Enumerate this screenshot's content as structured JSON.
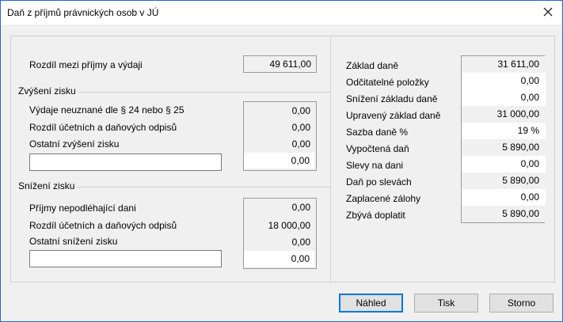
{
  "window": {
    "title": "Daň z příjmů právnických osob v JÚ"
  },
  "left": {
    "diff_label": "Rozdíl mezi příjmy a výdaji",
    "diff_value": "49 611,00",
    "increase": {
      "title": "Zvýšení zisku",
      "rows": [
        {
          "label": "Výdaje neuznané dle § 24 nebo § 25",
          "value": "0,00"
        },
        {
          "label": "Rozdíl účetních a daňových odpisů",
          "value": "0,00"
        },
        {
          "label": "Ostatní zvýšení zisku",
          "value": "0,00"
        }
      ],
      "custom_label_value": "",
      "custom_value": "0,00"
    },
    "decrease": {
      "title": "Snížení zisku",
      "rows": [
        {
          "label": "Příjmy nepodléhající dani",
          "value": "0,00"
        },
        {
          "label": "Rozdíl účetních a daňových odpisů",
          "value": "18 000,00"
        },
        {
          "label": "Ostatní snížení zisku",
          "value": "0,00"
        }
      ],
      "custom_label_value": "",
      "custom_value": "0,00"
    }
  },
  "right": {
    "rows": [
      {
        "label": "Základ daně",
        "value": "31 611,00"
      },
      {
        "label": "Odčitatelné položky",
        "value": "0,00"
      },
      {
        "label": "Snížení základu daně",
        "value": "0,00"
      },
      {
        "label": "Upravený základ daně",
        "value": "31 000,00"
      },
      {
        "label": "Sazba daně %",
        "value": "19 %"
      },
      {
        "label": "Vypočtená daň",
        "value": "5 890,00"
      },
      {
        "label": "Slevy na dani",
        "value": "0,00"
      },
      {
        "label": "Daň po slevách",
        "value": "5 890,00"
      },
      {
        "label": "Zaplacené zálohy",
        "value": "0,00"
      },
      {
        "label": "Zbývá doplatit",
        "value": "5 890,00"
      }
    ]
  },
  "buttons": {
    "preview": "Náhled",
    "print": "Tisk",
    "cancel": "Storno"
  }
}
